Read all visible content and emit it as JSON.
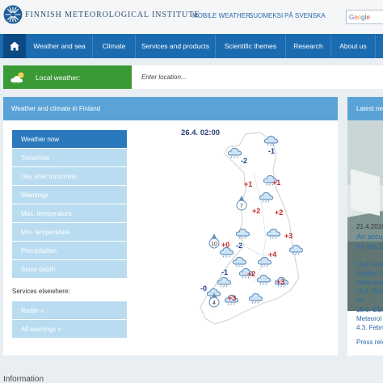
{
  "header": {
    "brand": "FINNISH METEOROLOGICAL INSTITUTE",
    "links": [
      "MOBILE WEATHER",
      "SUOMEKSI",
      "PÅ SVENSKA"
    ],
    "search_placeholder": "Google Custom Search"
  },
  "nav": {
    "home_icon": "home-icon",
    "items": [
      "Weather and sea",
      "Climate",
      "Services and products",
      "Scientific themes",
      "Research",
      "About us"
    ]
  },
  "local_weather": {
    "label": "Local weather:",
    "placeholder": "Enter location..."
  },
  "weather_panel": {
    "title": "Weather and climate in Finland",
    "menu": [
      "Weather now",
      "Tomorrow",
      "Day after tomorrow",
      "Warnings",
      "Max. temperature",
      "Min. temperature",
      "Precipitation",
      "Snow depth"
    ],
    "active_index": 0,
    "services_heading": "Services elsewhere:",
    "services": [
      "Radar »",
      "All warnings »"
    ]
  },
  "map": {
    "time": "26.4. 02:00",
    "temperatures": [
      "-1",
      "-2",
      "+1",
      "+1",
      "+2",
      "+2",
      "+3",
      "+0",
      "-2",
      "+4",
      "-1",
      "+2",
      "+3",
      "-0",
      "+3"
    ],
    "wind_speeds": [
      "7",
      "10",
      "4"
    ]
  },
  "news": {
    "title": "Latest news",
    "date": "21.4.2016",
    "headline_1": "An accurate",
    "headline_2": "for the Ea",
    "lines": [
      "18.4. Firs",
      "number c",
      "cities and",
      "11.4. Dryi",
      "air",
      "18.3. ESA",
      "Meteorol",
      "4.3. Febru"
    ],
    "more": "Press rele"
  },
  "footer": {
    "information_heading": "Information"
  },
  "colors": {
    "nav_blue": "#1a6bb0",
    "home_dark": "#0c4a84",
    "local_green": "#3a9a36",
    "panel_header": "#5aa3d8",
    "menu_active": "#2b79bd",
    "menu_inactive": "#b9dcf0",
    "temp_positive": "#c62828",
    "temp_negative": "#1a3f8a"
  }
}
